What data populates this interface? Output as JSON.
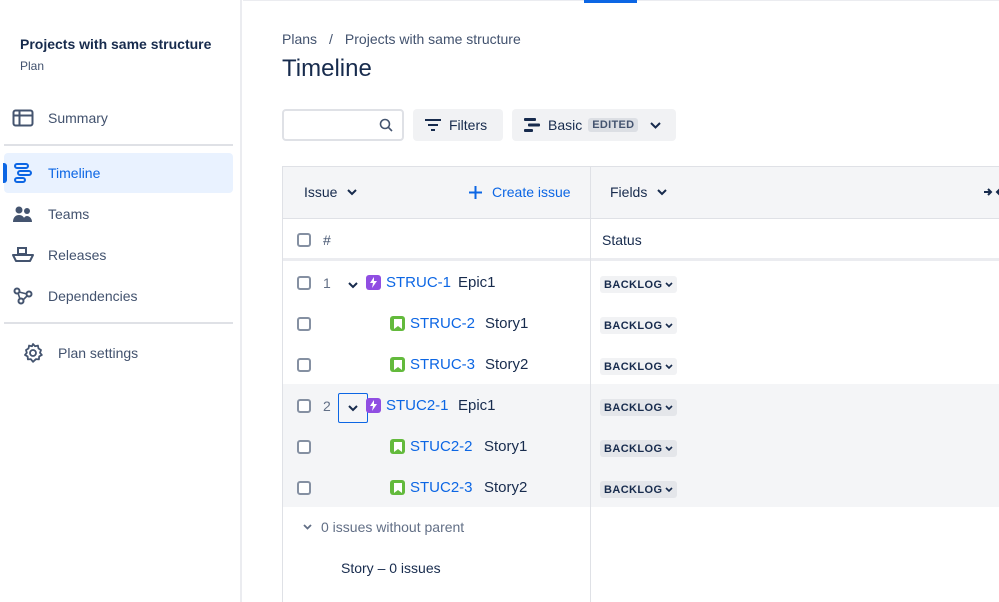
{
  "project": {
    "title": "Projects with same structure",
    "subtitle": "Plan"
  },
  "sidebar": {
    "items": [
      {
        "label": "Summary",
        "icon": "summary-icon"
      },
      {
        "label": "Timeline",
        "icon": "timeline-icon",
        "active": true
      },
      {
        "label": "Teams",
        "icon": "teams-icon"
      },
      {
        "label": "Releases",
        "icon": "releases-icon"
      },
      {
        "label": "Dependencies",
        "icon": "dependencies-icon"
      }
    ],
    "settings_label": "Plan settings"
  },
  "breadcrumb": {
    "root": "Plans",
    "separator": "/",
    "current": "Projects with same structure"
  },
  "page": {
    "title": "Timeline"
  },
  "toolbar": {
    "search_value": "",
    "filters_label": "Filters",
    "view_label": "Basic",
    "view_badge": "EDITED"
  },
  "table": {
    "issue_header": "Issue",
    "create_label": "Create issue",
    "fields_header": "Fields",
    "hash_header": "#",
    "status_header": "Status",
    "rows": [
      {
        "num": "1",
        "type": "epic",
        "key": "STRUC-1",
        "summary": "Epic1",
        "status": "BACKLOG"
      },
      {
        "num": "",
        "type": "story",
        "key": "STRUC-2",
        "summary": "Story1",
        "status": "BACKLOG"
      },
      {
        "num": "",
        "type": "story",
        "key": "STRUC-3",
        "summary": "Story2",
        "status": "BACKLOG"
      },
      {
        "num": "2",
        "type": "epic",
        "key": "STUC2-1",
        "summary": "Epic1",
        "status": "BACKLOG"
      },
      {
        "num": "",
        "type": "story",
        "key": "STUC2-2",
        "summary": "Story1",
        "status": "BACKLOG"
      },
      {
        "num": "",
        "type": "story",
        "key": "STUC2-3",
        "summary": "Story2",
        "status": "BACKLOG"
      }
    ],
    "no_parent_label": "0 issues without parent",
    "story_count_label": "Story – 0 issues"
  },
  "colors": {
    "accent": "#0c66e4",
    "epic": "#904ee2",
    "story": "#63ba3c"
  }
}
